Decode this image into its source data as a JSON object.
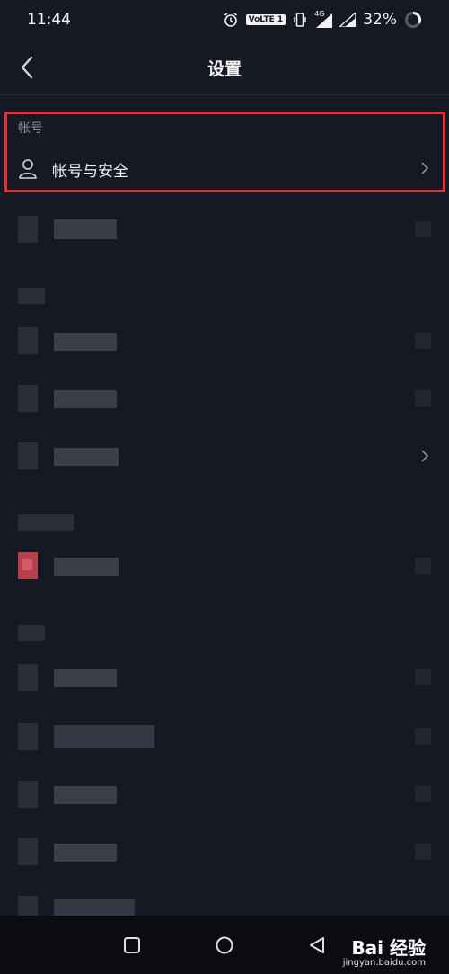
{
  "status_bar": {
    "time": "11:44",
    "volte": "VoLTE 1",
    "network": "4G",
    "battery": "32%"
  },
  "header": {
    "title": "设置",
    "back_icon": "chevron-left-icon"
  },
  "account_section": {
    "label": "帐号",
    "items": [
      {
        "label": "帐号与安全",
        "icon": "person-icon",
        "chevron": "chevron-right-icon"
      }
    ]
  },
  "nav_bar": {
    "buttons": [
      "recent-apps-icon",
      "home-icon",
      "back-triangle-icon"
    ]
  },
  "watermark": {
    "logo": "Bai 经验",
    "sub": "jingyan.baidu.com"
  },
  "colors": {
    "background": "#161823",
    "highlight": "#e62c3d",
    "text_primary": "#f0f0f2",
    "text_secondary": "#8e8f98"
  }
}
